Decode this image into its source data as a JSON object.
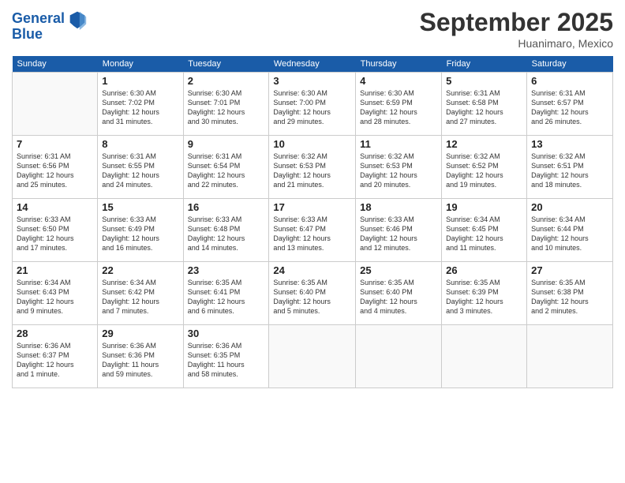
{
  "logo": {
    "line1": "General",
    "line2": "Blue"
  },
  "title": "September 2025",
  "location": "Huanimaro, Mexico",
  "days_of_week": [
    "Sunday",
    "Monday",
    "Tuesday",
    "Wednesday",
    "Thursday",
    "Friday",
    "Saturday"
  ],
  "weeks": [
    [
      {
        "num": "",
        "info": ""
      },
      {
        "num": "1",
        "info": "Sunrise: 6:30 AM\nSunset: 7:02 PM\nDaylight: 12 hours\nand 31 minutes."
      },
      {
        "num": "2",
        "info": "Sunrise: 6:30 AM\nSunset: 7:01 PM\nDaylight: 12 hours\nand 30 minutes."
      },
      {
        "num": "3",
        "info": "Sunrise: 6:30 AM\nSunset: 7:00 PM\nDaylight: 12 hours\nand 29 minutes."
      },
      {
        "num": "4",
        "info": "Sunrise: 6:30 AM\nSunset: 6:59 PM\nDaylight: 12 hours\nand 28 minutes."
      },
      {
        "num": "5",
        "info": "Sunrise: 6:31 AM\nSunset: 6:58 PM\nDaylight: 12 hours\nand 27 minutes."
      },
      {
        "num": "6",
        "info": "Sunrise: 6:31 AM\nSunset: 6:57 PM\nDaylight: 12 hours\nand 26 minutes."
      }
    ],
    [
      {
        "num": "7",
        "info": "Sunrise: 6:31 AM\nSunset: 6:56 PM\nDaylight: 12 hours\nand 25 minutes."
      },
      {
        "num": "8",
        "info": "Sunrise: 6:31 AM\nSunset: 6:55 PM\nDaylight: 12 hours\nand 24 minutes."
      },
      {
        "num": "9",
        "info": "Sunrise: 6:31 AM\nSunset: 6:54 PM\nDaylight: 12 hours\nand 22 minutes."
      },
      {
        "num": "10",
        "info": "Sunrise: 6:32 AM\nSunset: 6:53 PM\nDaylight: 12 hours\nand 21 minutes."
      },
      {
        "num": "11",
        "info": "Sunrise: 6:32 AM\nSunset: 6:53 PM\nDaylight: 12 hours\nand 20 minutes."
      },
      {
        "num": "12",
        "info": "Sunrise: 6:32 AM\nSunset: 6:52 PM\nDaylight: 12 hours\nand 19 minutes."
      },
      {
        "num": "13",
        "info": "Sunrise: 6:32 AM\nSunset: 6:51 PM\nDaylight: 12 hours\nand 18 minutes."
      }
    ],
    [
      {
        "num": "14",
        "info": "Sunrise: 6:33 AM\nSunset: 6:50 PM\nDaylight: 12 hours\nand 17 minutes."
      },
      {
        "num": "15",
        "info": "Sunrise: 6:33 AM\nSunset: 6:49 PM\nDaylight: 12 hours\nand 16 minutes."
      },
      {
        "num": "16",
        "info": "Sunrise: 6:33 AM\nSunset: 6:48 PM\nDaylight: 12 hours\nand 14 minutes."
      },
      {
        "num": "17",
        "info": "Sunrise: 6:33 AM\nSunset: 6:47 PM\nDaylight: 12 hours\nand 13 minutes."
      },
      {
        "num": "18",
        "info": "Sunrise: 6:33 AM\nSunset: 6:46 PM\nDaylight: 12 hours\nand 12 minutes."
      },
      {
        "num": "19",
        "info": "Sunrise: 6:34 AM\nSunset: 6:45 PM\nDaylight: 12 hours\nand 11 minutes."
      },
      {
        "num": "20",
        "info": "Sunrise: 6:34 AM\nSunset: 6:44 PM\nDaylight: 12 hours\nand 10 minutes."
      }
    ],
    [
      {
        "num": "21",
        "info": "Sunrise: 6:34 AM\nSunset: 6:43 PM\nDaylight: 12 hours\nand 9 minutes."
      },
      {
        "num": "22",
        "info": "Sunrise: 6:34 AM\nSunset: 6:42 PM\nDaylight: 12 hours\nand 7 minutes."
      },
      {
        "num": "23",
        "info": "Sunrise: 6:35 AM\nSunset: 6:41 PM\nDaylight: 12 hours\nand 6 minutes."
      },
      {
        "num": "24",
        "info": "Sunrise: 6:35 AM\nSunset: 6:40 PM\nDaylight: 12 hours\nand 5 minutes."
      },
      {
        "num": "25",
        "info": "Sunrise: 6:35 AM\nSunset: 6:40 PM\nDaylight: 12 hours\nand 4 minutes."
      },
      {
        "num": "26",
        "info": "Sunrise: 6:35 AM\nSunset: 6:39 PM\nDaylight: 12 hours\nand 3 minutes."
      },
      {
        "num": "27",
        "info": "Sunrise: 6:35 AM\nSunset: 6:38 PM\nDaylight: 12 hours\nand 2 minutes."
      }
    ],
    [
      {
        "num": "28",
        "info": "Sunrise: 6:36 AM\nSunset: 6:37 PM\nDaylight: 12 hours\nand 1 minute."
      },
      {
        "num": "29",
        "info": "Sunrise: 6:36 AM\nSunset: 6:36 PM\nDaylight: 11 hours\nand 59 minutes."
      },
      {
        "num": "30",
        "info": "Sunrise: 6:36 AM\nSunset: 6:35 PM\nDaylight: 11 hours\nand 58 minutes."
      },
      {
        "num": "",
        "info": ""
      },
      {
        "num": "",
        "info": ""
      },
      {
        "num": "",
        "info": ""
      },
      {
        "num": "",
        "info": ""
      }
    ]
  ]
}
